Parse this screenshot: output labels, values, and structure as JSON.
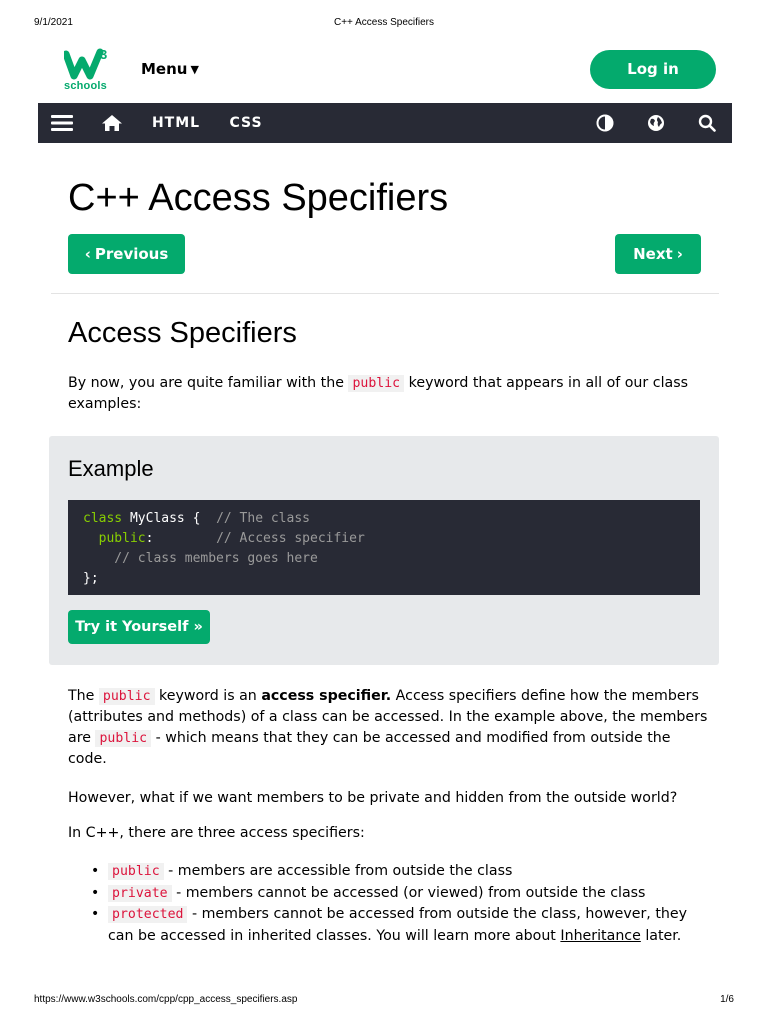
{
  "print_header": {
    "date": "9/1/2021",
    "title": "C++ Access Specifiers"
  },
  "topbar": {
    "logo_sup": "3",
    "logo_text": "schools",
    "menu_label": "Menu",
    "login_label": "Log in"
  },
  "navbar": {
    "items": [
      "HTML",
      "CSS"
    ],
    "icons": [
      "hamburger-icon",
      "home-icon",
      "contrast-icon",
      "globe-icon",
      "search-icon"
    ]
  },
  "page": {
    "title": "C++ Access Specifiers",
    "prev_label": "Previous",
    "next_label": "Next",
    "section_title": "Access Specifiers",
    "intro_before": "By now, you are quite familiar with the ",
    "intro_kw": "public",
    "intro_after": " keyword that appears in all of our class examples:",
    "example": {
      "heading": "Example",
      "code": {
        "l1_kw": "class",
        "l1_name": " MyClass {  ",
        "l1_comment": "// The class",
        "l2_kw": "  public",
        "l2_colon": ":        ",
        "l2_comment": "// Access specifier",
        "l3_comment": "    // class members goes here",
        "l4": "};"
      },
      "try_label": "Try it Yourself »"
    },
    "p2": {
      "t1": "The ",
      "kw1": "public",
      "t2": " keyword is an ",
      "bold": "access specifier.",
      "t3": " Access specifiers define how the members (attributes and methods) of a class can be accessed. In the example above, the members are ",
      "kw2": "public",
      "t4": " - which means that they can be accessed and modified from outside the code."
    },
    "p3": "However, what if we want members to be private and hidden from the outside world?",
    "p4": "In C++, there are three access specifiers:",
    "specs": [
      {
        "kw": "public",
        "text": " - members are accessible from outside the class"
      },
      {
        "kw": "private",
        "text": " - members cannot be accessed (or viewed) from outside the class"
      },
      {
        "kw": "protected",
        "text": " - members cannot be accessed from outside the class, however, they can be accessed in inherited classes. You will learn more about ",
        "link": "Inheritance",
        "text_after": " later."
      }
    ]
  },
  "print_footer": {
    "url": "https://www.w3schools.com/cpp/cpp_access_specifiers.asp",
    "page": "1/6"
  },
  "colors": {
    "accent": "#04AA6D",
    "navbar": "#282A35",
    "keyword": "#DC143C",
    "example_bg": "#E7E9EB"
  }
}
